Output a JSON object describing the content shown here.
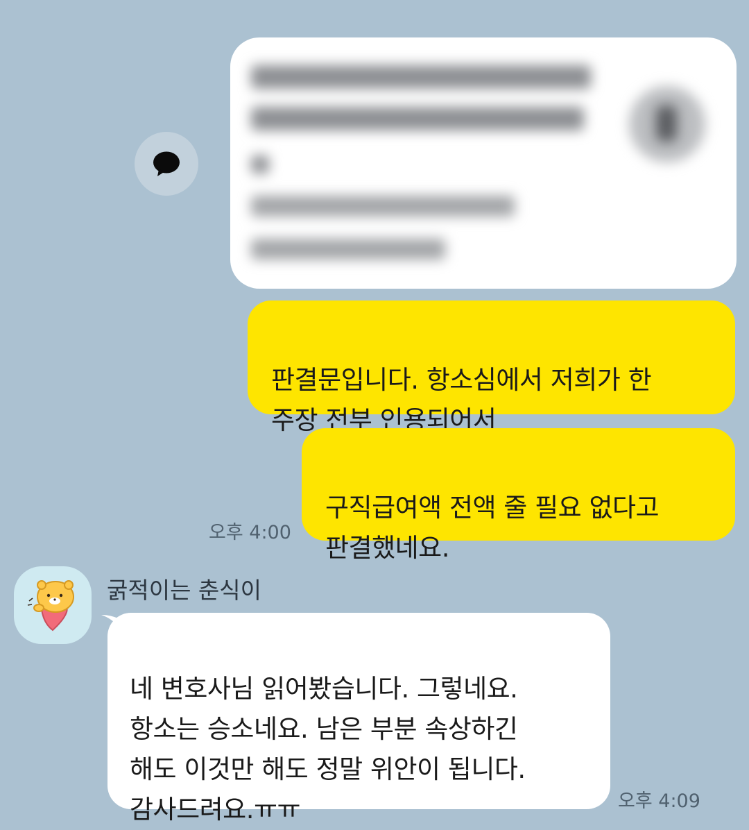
{
  "conversation": {
    "outgoing": [
      {
        "text": "판결문입니다. 항소심에서 저희가 한\n주장 전부 인용되어서"
      },
      {
        "text": "구직급여액 전액 줄 필요 없다고\n판결했네요."
      }
    ],
    "outgoing_time": "오후 4:00",
    "incoming": {
      "sender": "굵적이는 춘식이",
      "text": "네 변호사님 읽어봤습니다. 그렇네요.\n항소는 승소네요. 남은 부분 속상하긴\n해도 이것만 해도 정말 위안이 됩니다.\n감사드려요.ㅠㅠ",
      "time": "오후 4:09"
    }
  },
  "icons": {
    "share": "speech-bubble-icon",
    "avatar": "chunsik-character-avatar",
    "preview": "blurred-link-preview"
  },
  "colors": {
    "background": "#abc1d1",
    "outgoing_bubble": "#fee500",
    "incoming_bubble": "#ffffff"
  }
}
